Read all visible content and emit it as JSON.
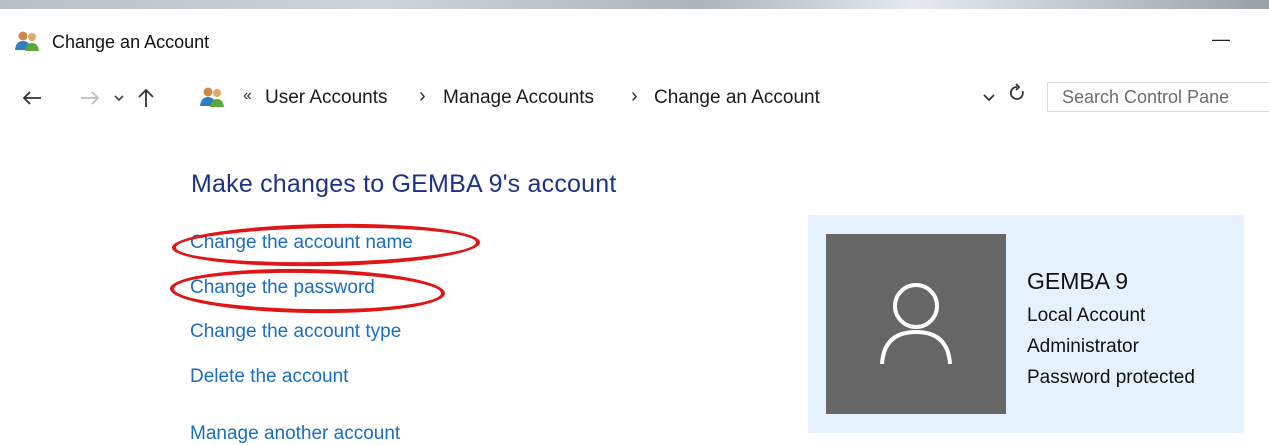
{
  "window": {
    "title": "Change an Account",
    "minimize_glyph": "—"
  },
  "navigation": {
    "back_icon": "arrow-left-icon",
    "forward_icon": "arrow-right-icon",
    "recent_icon": "chevron-down-icon",
    "up_icon": "arrow-up-icon",
    "overflow_glyph": "«",
    "breadcrumbs": [
      {
        "label": "User Accounts"
      },
      {
        "label": "Manage Accounts"
      },
      {
        "label": "Change an Account"
      }
    ],
    "separator_glyph": "›",
    "refresh_icon": "refresh-icon",
    "search_placeholder": "Search Control Pane"
  },
  "main": {
    "heading": "Make changes to GEMBA 9's account",
    "tasks": [
      {
        "label": "Change the account name",
        "highlighted": true
      },
      {
        "label": "Change the password",
        "highlighted": true
      },
      {
        "label": "Change the account type",
        "highlighted": false
      },
      {
        "label": "Delete the account",
        "highlighted": false
      },
      {
        "label": "Manage another account",
        "highlighted": false
      }
    ],
    "highlight_color": "#e01515",
    "link_color": "#1a6ec0",
    "heading_color": "#1e3287"
  },
  "account": {
    "name": "GEMBA 9",
    "type": "Local Account",
    "role": "Administrator",
    "protection": "Password protected",
    "avatar_icon": "user-avatar-icon",
    "card_color": "#e5f2fd",
    "avatar_color": "#666666"
  }
}
